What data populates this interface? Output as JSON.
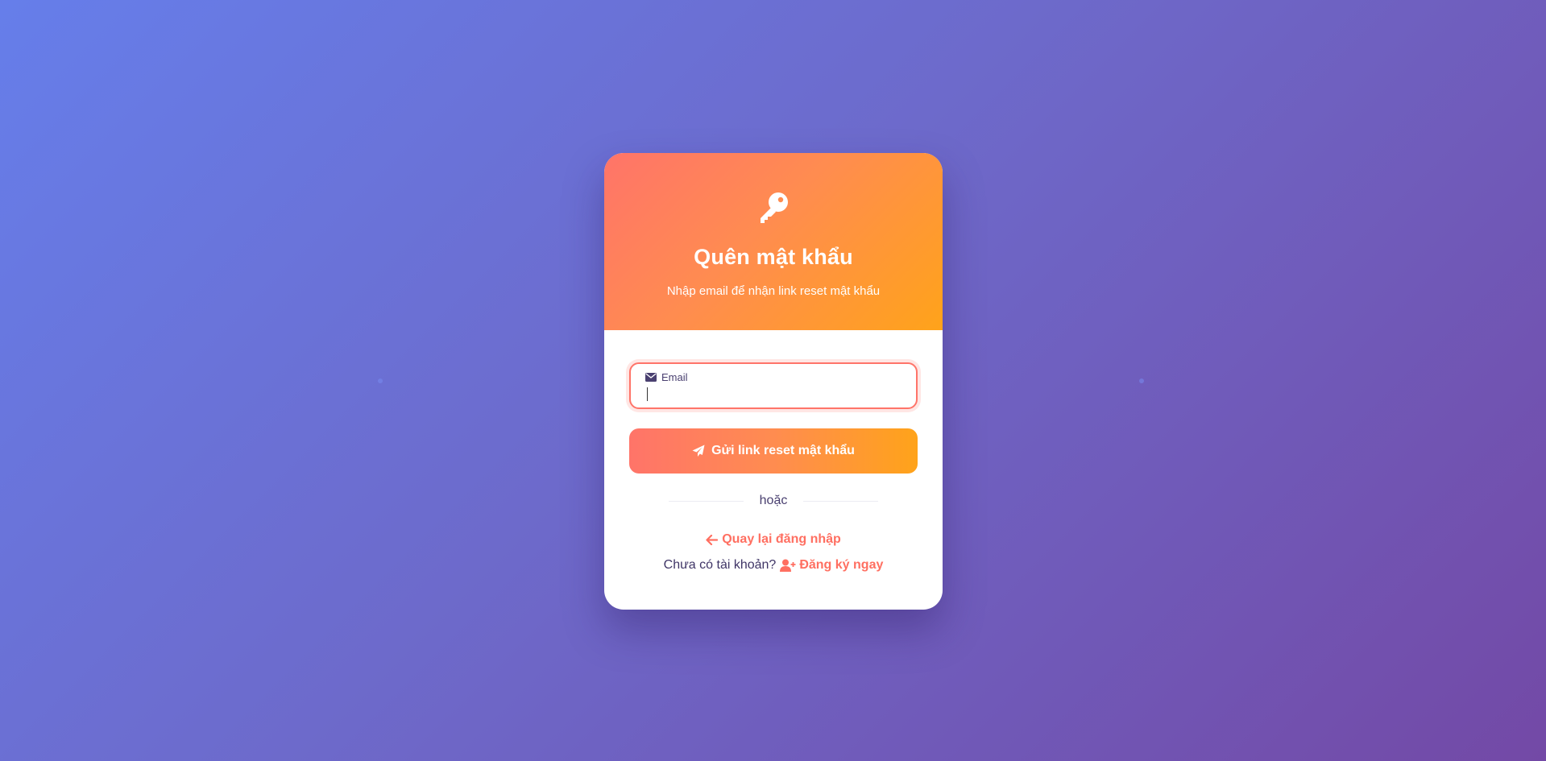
{
  "header": {
    "icon": "key-icon",
    "title": "Quên mật khẩu",
    "subtitle": "Nhập email để nhận link reset mật khẩu"
  },
  "form": {
    "email_label": "Email",
    "email_icon": "envelope-icon",
    "email_value": "",
    "email_placeholder": "",
    "submit_label": "Gửi link reset mật khẩu",
    "submit_icon": "paper-plane-icon"
  },
  "divider": {
    "text": "hoặc"
  },
  "links": {
    "back_label": "Quay lại đăng nhập",
    "back_icon": "arrow-left-icon",
    "no_account_text": "Chưa có tài khoản?",
    "register_label": "Đăng ký ngay",
    "register_icon": "user-plus-icon"
  },
  "colors": {
    "background_start": "#667eea",
    "background_end": "#7349a6",
    "accent_start": "#ff7469",
    "accent_end": "#ffa31a",
    "link": "#ff6f61",
    "text_dark": "#3f3566"
  }
}
